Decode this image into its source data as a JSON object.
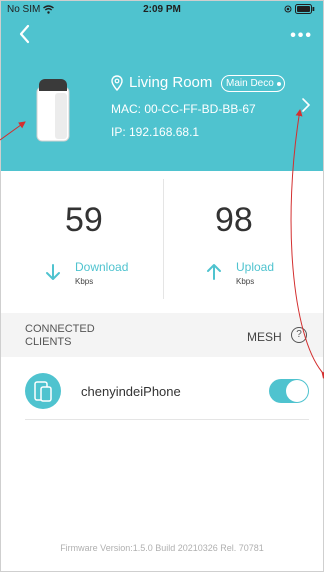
{
  "status": {
    "carrier": "No SIM",
    "time": "2:09 PM"
  },
  "device": {
    "name": "Living Room",
    "role_badge": "Main Deco",
    "mac": "MAC: 00-CC-FF-BD-BB-67",
    "ip": "IP: 192.168.68.1"
  },
  "stats": {
    "download": {
      "value": "59",
      "label": "Download",
      "unit": "Kbps"
    },
    "upload": {
      "value": "98",
      "label": "Upload",
      "unit": "Kbps"
    }
  },
  "clients_section": {
    "title": "CONNECTED CLIENTS",
    "mesh_label": "MESH",
    "help": "?"
  },
  "clients": [
    {
      "name": "chenyindeiPhone",
      "enabled": true
    }
  ],
  "footer": {
    "firmware": "Firmware Version:1.5.0 Build 20210326 Rel. 70781"
  },
  "colors": {
    "accent": "#4fc3cf",
    "annotation": "#d32f2f"
  }
}
